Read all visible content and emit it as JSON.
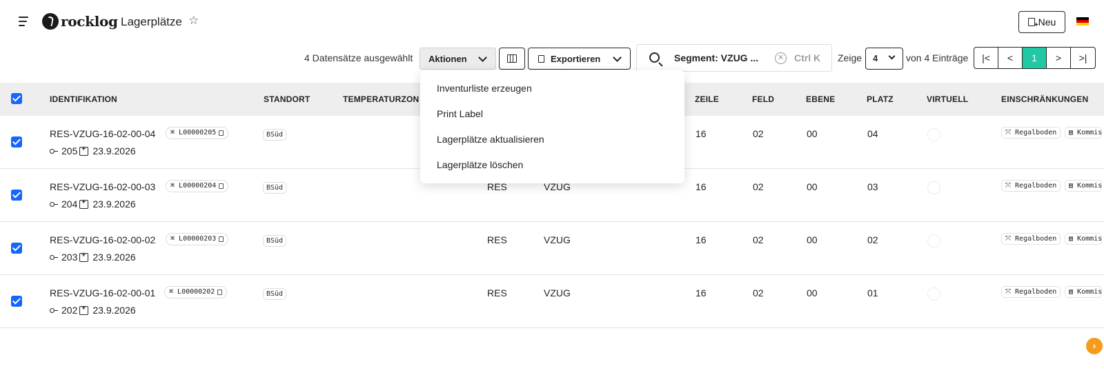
{
  "header": {
    "logo_text": "rocklog",
    "page_title": "Lagerplätze",
    "new_button_label": "Neu",
    "flag_colors": [
      "#000000",
      "#dd0000",
      "#ffce00"
    ]
  },
  "toolbar": {
    "selected_text": "4 Datensätze ausgewählt",
    "actions_label": "Aktionen",
    "export_label": "Exportieren",
    "search_text": "Segment: VZUG ...",
    "shortcut": "Ctrl K",
    "show_label": "Zeige",
    "page_size": "4",
    "entries_label": "von 4 Einträge",
    "pager": [
      "|<",
      "<",
      "1",
      ">",
      ">|"
    ]
  },
  "menu": {
    "items": [
      "Inventurliste erzeugen",
      "Print Label",
      "Lagerplätze aktualisieren",
      "Lagerplätze löschen"
    ]
  },
  "table": {
    "columns": [
      "IDENTIFIKATION",
      "STANDORT",
      "TEMPERATURZON",
      "ZEILE",
      "FELD",
      "EBENE",
      "PLATZ",
      "VIRTUELL",
      "EINSCHRÄNKUNGEN"
    ],
    "rows": [
      {
        "id": "RES-VZUG-16-02-00-04",
        "label": "L00000205",
        "key": "205",
        "date": "23.9.2026",
        "standort": "BSüd",
        "area": "",
        "segment": "",
        "zeile": "16",
        "feld": "02",
        "ebene": "00",
        "platz": "04",
        "chip1": "Regalboden",
        "chip2": "Kommis"
      },
      {
        "id": "RES-VZUG-16-02-00-03",
        "label": "L00000204",
        "key": "204",
        "date": "23.9.2026",
        "standort": "BSüd",
        "area": "RES",
        "segment": "VZUG",
        "zeile": "16",
        "feld": "02",
        "ebene": "00",
        "platz": "03",
        "chip1": "Regalboden",
        "chip2": "Kommis"
      },
      {
        "id": "RES-VZUG-16-02-00-02",
        "label": "L00000203",
        "key": "203",
        "date": "23.9.2026",
        "standort": "BSüd",
        "area": "RES",
        "segment": "VZUG",
        "zeile": "16",
        "feld": "02",
        "ebene": "00",
        "platz": "02",
        "chip1": "Regalboden",
        "chip2": "Kommis"
      },
      {
        "id": "RES-VZUG-16-02-00-01",
        "label": "L00000202",
        "key": "202",
        "date": "23.9.2026",
        "standort": "BSüd",
        "area": "RES",
        "segment": "VZUG",
        "zeile": "16",
        "feld": "02",
        "ebene": "00",
        "platz": "01",
        "chip1": "Regalboden",
        "chip2": "Kommis"
      }
    ]
  },
  "fab_label": "›"
}
